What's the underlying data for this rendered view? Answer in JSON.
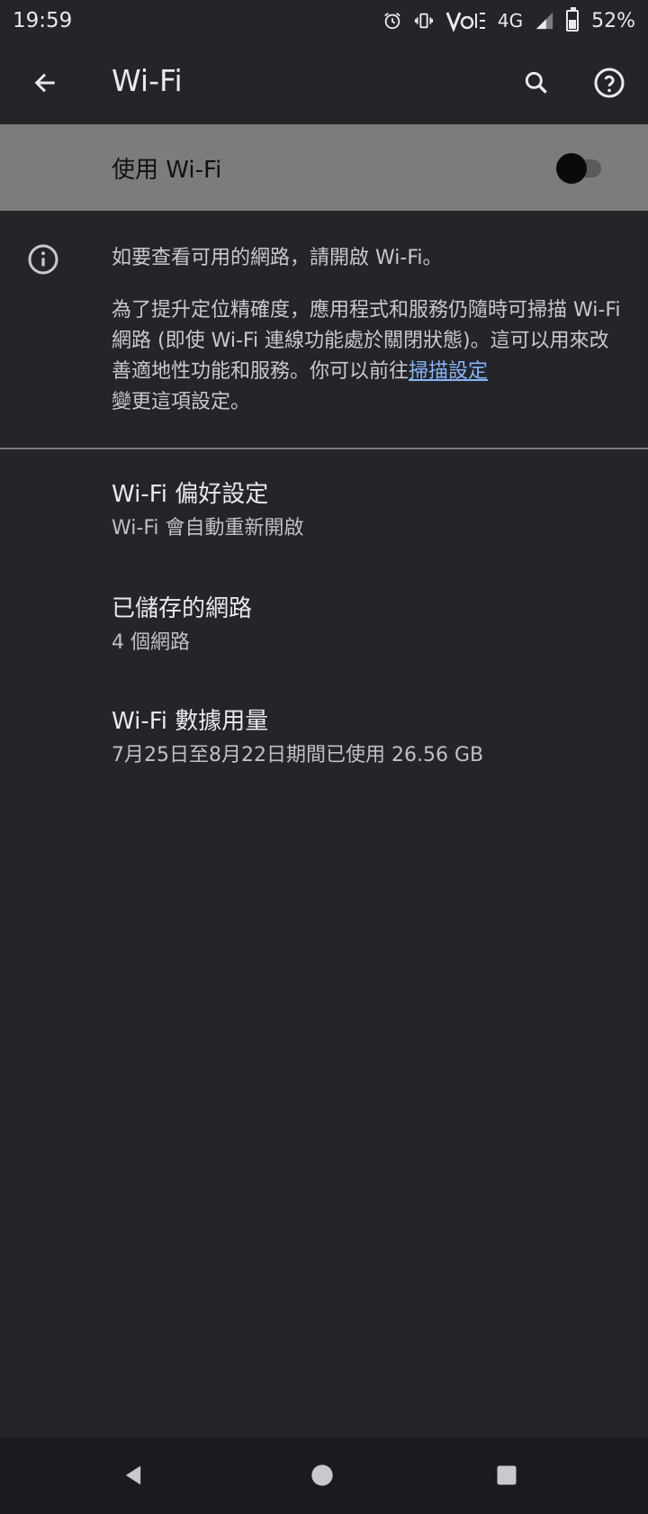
{
  "status_bar": {
    "time": "19:59",
    "network": "4G",
    "battery_percent": "52%",
    "battery_level": 0.52,
    "icons": [
      "alarm-icon",
      "vibrate-icon",
      "volte-icon",
      "signal-icon",
      "battery-icon"
    ]
  },
  "app_bar": {
    "title": "Wi-Fi",
    "back_icon": "arrow-back-icon",
    "search_icon": "search-icon",
    "help_icon": "help-icon"
  },
  "master_switch": {
    "label": "使用 Wi-Fi",
    "checked": false
  },
  "info": {
    "line1": "如要查看可用的網路，請開啟 Wi-Fi。",
    "para_text": "為了提升定位精確度，應用程式和服務仍隨時可掃描 Wi-Fi 網路 (即使 Wi-Fi 連線功能處於關閉狀態)。這可以用來改善適地性功能和服務。你可以前往",
    "para_link": "掃描設定",
    "para_tail": "變更這項設定。"
  },
  "list": [
    {
      "title": "Wi-Fi 偏好設定",
      "subtitle": "Wi-Fi 會自動重新開啟"
    },
    {
      "title": "已儲存的網路",
      "subtitle": "4 個網路"
    },
    {
      "title": "Wi-Fi 數據用量",
      "subtitle": "7月25日至8月22日期間已使用 26.56 GB"
    }
  ],
  "colors": {
    "background": "#232529",
    "switch_bar": "#7c7c7c",
    "link": "#8ab4f8",
    "nav_bar": "#1a1b1e"
  }
}
